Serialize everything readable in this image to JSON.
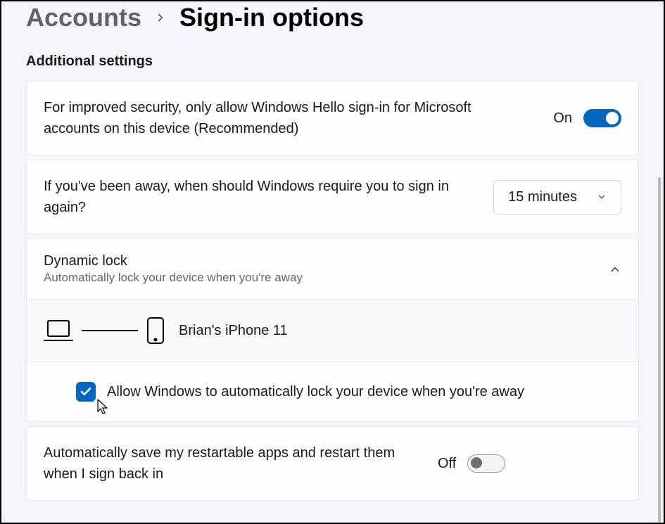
{
  "breadcrumb": {
    "parent": "Accounts",
    "current": "Sign-in options"
  },
  "section_title": "Additional settings",
  "hello": {
    "text": "For improved security, only allow Windows Hello sign-in for Microsoft accounts on this device (Recommended)",
    "state_label": "On",
    "state": true
  },
  "away": {
    "text": "If you've been away, when should Windows require you to sign in again?",
    "value": "15 minutes"
  },
  "dynamic_lock": {
    "title": "Dynamic lock",
    "subtitle": "Automatically lock your device when you're away",
    "device_name": "Brian's iPhone 11",
    "checkbox_label": "Allow Windows to automatically lock your device when you're away",
    "checkbox_state": true
  },
  "restart_apps": {
    "text": "Automatically save my restartable apps and restart them when I sign back in",
    "state_label": "Off",
    "state": false
  }
}
